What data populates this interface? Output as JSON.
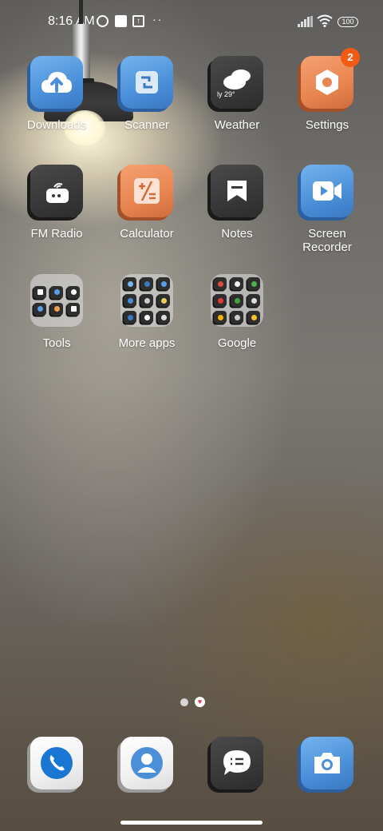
{
  "status_bar": {
    "time": "8:16 AM",
    "notification_arrow": "↑",
    "more": "··",
    "battery": "100"
  },
  "apps": [
    {
      "label": "Downloads",
      "icon": "cloud-upload-icon"
    },
    {
      "label": "Scanner",
      "icon": "scanner-icon"
    },
    {
      "label": "Weather",
      "icon": "weather-icon",
      "icon_text": "ly 29°"
    },
    {
      "label": "Settings",
      "icon": "gear-icon",
      "badge": "2"
    },
    {
      "label": "FM Radio",
      "icon": "radio-icon"
    },
    {
      "label": "Calculator",
      "icon": "calculator-icon"
    },
    {
      "label": "Notes",
      "icon": "notes-icon"
    },
    {
      "label": "Screen Recorder",
      "icon": "video-camera-icon"
    },
    {
      "label": "Tools",
      "icon": "folder-icon"
    },
    {
      "label": "More apps",
      "icon": "folder-icon"
    },
    {
      "label": "Google",
      "icon": "folder-icon"
    }
  ],
  "dock": [
    {
      "name": "phone",
      "icon": "phone-icon"
    },
    {
      "name": "contacts",
      "icon": "contacts-icon"
    },
    {
      "name": "messages",
      "icon": "message-icon"
    },
    {
      "name": "camera",
      "icon": "camera-icon"
    }
  ],
  "page_indicator": {
    "pages": 2,
    "current": 2
  },
  "colors": {
    "accent_blue": "#4a8fd8",
    "accent_orange": "#e98550",
    "badge": "#f35a13"
  }
}
